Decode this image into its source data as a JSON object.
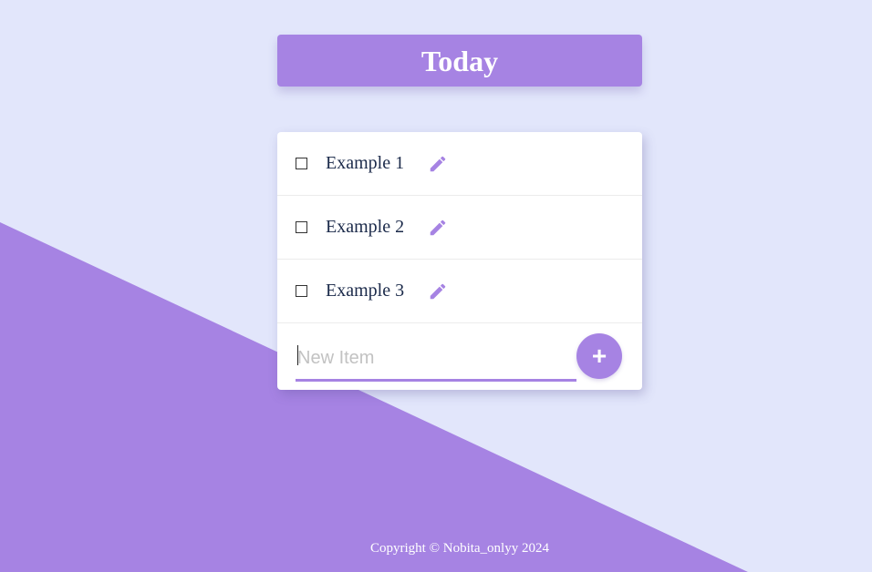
{
  "header": {
    "title": "Today"
  },
  "list": {
    "items": [
      {
        "label": "Example 1"
      },
      {
        "label": "Example 2"
      },
      {
        "label": "Example 3"
      }
    ],
    "new_item_placeholder": "New Item",
    "add_button_label": "+"
  },
  "footer": {
    "text": "Copyright © Nobita_onlyy 2024"
  },
  "colors": {
    "accent": "#a683e3",
    "background": "#e2e6fb"
  },
  "icons": {
    "edit": "pencil-icon"
  }
}
